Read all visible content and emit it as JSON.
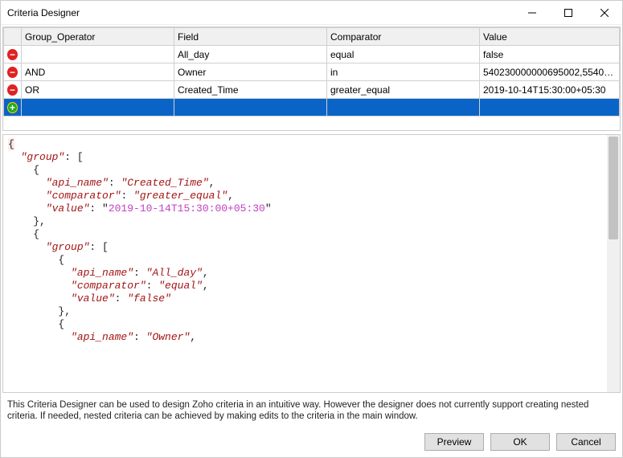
{
  "window": {
    "title": "Criteria Designer"
  },
  "grid": {
    "headers": {
      "group_operator": "Group_Operator",
      "field": "Field",
      "comparator": "Comparator",
      "value": "Value"
    },
    "rows": [
      {
        "op": "",
        "field": "All_day",
        "comparator": "equal",
        "value": "false"
      },
      {
        "op": "AND",
        "field": "Owner",
        "comparator": "in",
        "value": "540230000000695002,5540230000..."
      },
      {
        "op": "OR",
        "field": "Created_Time",
        "comparator": "greater_equal",
        "value": "2019-10-14T15:30:00+05:30"
      }
    ]
  },
  "json_preview": {
    "lines": [
      {
        "t": "brace",
        "txt": "{",
        "hl": true
      },
      {
        "t": "ki",
        "indent": 1,
        "key": "group",
        "after": ": ["
      },
      {
        "t": "brace",
        "indent": 2,
        "txt": "{"
      },
      {
        "t": "kv",
        "indent": 3,
        "key": "api_name",
        "val": "Created_Time",
        "comma": true
      },
      {
        "t": "kv",
        "indent": 3,
        "key": "comparator",
        "val": "greater_equal",
        "comma": true
      },
      {
        "t": "kvnum",
        "indent": 3,
        "key": "value",
        "val": "2019-10-14T15:30:00+05:30"
      },
      {
        "t": "brace",
        "indent": 2,
        "txt": "},"
      },
      {
        "t": "brace",
        "indent": 2,
        "txt": "{"
      },
      {
        "t": "ki",
        "indent": 3,
        "key": "group",
        "after": ": ["
      },
      {
        "t": "brace",
        "indent": 4,
        "txt": "{"
      },
      {
        "t": "kv",
        "indent": 5,
        "key": "api_name",
        "val": "All_day",
        "comma": true
      },
      {
        "t": "kv",
        "indent": 5,
        "key": "comparator",
        "val": "equal",
        "comma": true
      },
      {
        "t": "kv",
        "indent": 5,
        "key": "value",
        "val": "false"
      },
      {
        "t": "brace",
        "indent": 4,
        "txt": "},"
      },
      {
        "t": "brace",
        "indent": 4,
        "txt": "{"
      },
      {
        "t": "kv",
        "indent": 5,
        "key": "api_name",
        "val": "Owner",
        "comma": true
      }
    ]
  },
  "note": "This Criteria Designer can be used to design Zoho criteria in an intuitive way. However the designer does not currently support creating nested criteria. If needed, nested criteria can be achieved by making edits to the criteria in the main window.",
  "buttons": {
    "preview": "Preview",
    "ok": "OK",
    "cancel": "Cancel"
  },
  "chart_data": {
    "type": "table",
    "columns": [
      "Group_Operator",
      "Field",
      "Comparator",
      "Value"
    ],
    "rows": [
      [
        "",
        "All_day",
        "equal",
        "false"
      ],
      [
        "AND",
        "Owner",
        "in",
        "540230000000695002,5540230000..."
      ],
      [
        "OR",
        "Created_Time",
        "greater_equal",
        "2019-10-14T15:30:00+05:30"
      ]
    ]
  }
}
